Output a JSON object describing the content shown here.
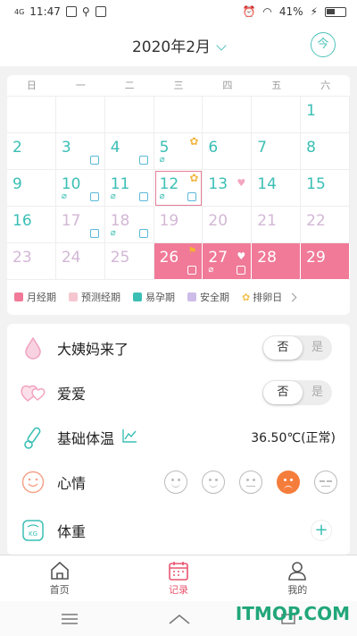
{
  "status": {
    "time": "11:47",
    "network": "4G",
    "battery": "41%"
  },
  "header": {
    "title": "2020年2月",
    "today_label": "今"
  },
  "calendar": {
    "weekdays": [
      "日",
      "一",
      "二",
      "三",
      "四",
      "五",
      "六"
    ],
    "rows": [
      [
        "",
        "",
        "",
        "",
        "",
        "",
        "1"
      ],
      [
        "2",
        "3",
        "4",
        "5",
        "6",
        "7",
        "8"
      ],
      [
        "9",
        "10",
        "11",
        "12",
        "13",
        "14",
        "15"
      ],
      [
        "16",
        "17",
        "18",
        "19",
        "20",
        "21",
        "22"
      ],
      [
        "23",
        "24",
        "25",
        "26",
        "27",
        "28",
        "29"
      ]
    ],
    "selected_day": "12",
    "colors": {
      "teal": "#3bbfb5",
      "period": "#f07a98",
      "muted": "#d3b7d6",
      "accent": "#4fc3ba"
    }
  },
  "legend": [
    {
      "label": "月经期",
      "color": "#f07a98"
    },
    {
      "label": "预测经期",
      "color": "#f5c6cf"
    },
    {
      "label": "易孕期",
      "color": "#3bbfb5"
    },
    {
      "label": "安全期",
      "color": "#cdbbe8"
    },
    {
      "label": "排卵日",
      "color": "#f2c14e"
    }
  ],
  "records": {
    "period": {
      "label": "大姨妈来了",
      "off": "否",
      "on": "是"
    },
    "love": {
      "label": "爱爱",
      "off": "否",
      "on": "是"
    },
    "temperature": {
      "label": "基础体温",
      "value": "36.50℃(正常)"
    },
    "mood": {
      "label": "心情"
    },
    "weight": {
      "label": "体重",
      "add": "+"
    }
  },
  "tabs": [
    {
      "label": "首页"
    },
    {
      "label": "记录"
    },
    {
      "label": "我的"
    }
  ],
  "watermark": "ITMOP.COM"
}
